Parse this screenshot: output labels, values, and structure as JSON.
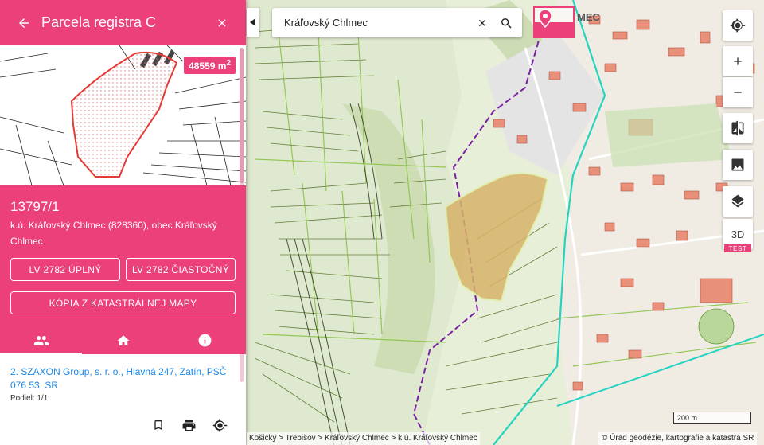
{
  "panel": {
    "title": "Parcela registra C",
    "area_value": "48559 m",
    "area_unit_sup": "2",
    "parcel_number": "13797/1",
    "location": "k.ú. Kráľovský Chlmec (828360), obec Kráľovský Chlmec",
    "btn_lv_full": "LV 2782 ÚPLNÝ",
    "btn_lv_partial": "LV 2782 ČIASTOČNÝ",
    "btn_copy_map": "KÓPIA Z KATASTRÁLNEJ MAPY",
    "owner": "2. SZAXON Group, s. r. o., Hlavná 247, Zatín, PSČ 076 53, SR",
    "share": "Podiel: 1/1"
  },
  "search": {
    "value": "Kráľovský Chlmec"
  },
  "map": {
    "btn_3d": "3D",
    "test_badge": "TEST",
    "scale_label": "200 m",
    "breadcrumb": "Košický > Trebišov > Kráľovský Chlmec > k.ú. Kráľovský Chlmec",
    "copyright": "© Úrad geodézie, kartografie a katastra SR",
    "town_label": "MEC"
  },
  "colors": {
    "accent": "#ec407a",
    "link": "#1e88e5",
    "parcel_fill": "#d7b26a"
  }
}
